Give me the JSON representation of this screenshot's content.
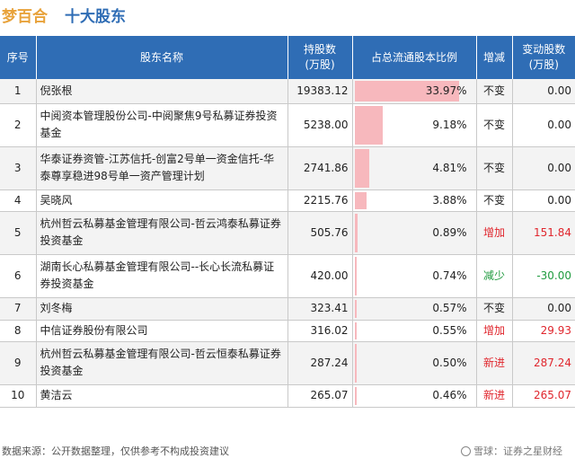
{
  "header": {
    "company": "梦百合",
    "subtitle": "十大股东"
  },
  "table": {
    "columns": {
      "rank": "序号",
      "name": "股东名称",
      "shares": "持股数\n(万股)",
      "ratio": "占总流通股本比例",
      "change": "增减",
      "delta": "变动股数\n(万股)"
    },
    "rows": [
      {
        "rank": "1",
        "name": "倪张根",
        "shares": "19383.12",
        "ratio_label": "33.97%",
        "ratio": 33.97,
        "change": "不变",
        "change_color": "#222222",
        "delta": "0.00"
      },
      {
        "rank": "2",
        "name": "中阅资本管理股份公司-中阅聚焦9号私募证券投资基金",
        "shares": "5238.00",
        "ratio_label": "9.18%",
        "ratio": 9.18,
        "change": "不变",
        "change_color": "#222222",
        "delta": "0.00"
      },
      {
        "rank": "3",
        "name": "华泰证券资管-江苏信托-创富2号单一资金信托-华泰尊享稳进98号单一资产管理计划",
        "shares": "2741.86",
        "ratio_label": "4.81%",
        "ratio": 4.81,
        "change": "不变",
        "change_color": "#222222",
        "delta": "0.00"
      },
      {
        "rank": "4",
        "name": "吴晓风",
        "shares": "2215.76",
        "ratio_label": "3.88%",
        "ratio": 3.88,
        "change": "不变",
        "change_color": "#222222",
        "delta": "0.00"
      },
      {
        "rank": "5",
        "name": "杭州哲云私募基金管理有限公司-哲云鸿泰私募证券投资基金",
        "shares": "505.76",
        "ratio_label": "0.89%",
        "ratio": 0.89,
        "change": "增加",
        "change_color": "#e0262d",
        "delta": "151.84"
      },
      {
        "rank": "6",
        "name": "湖南长心私募基金管理有限公司--长心长流私募证券投资基金",
        "shares": "420.00",
        "ratio_label": "0.74%",
        "ratio": 0.74,
        "change": "减少",
        "change_color": "#1e9a3e",
        "delta": "-30.00"
      },
      {
        "rank": "7",
        "name": "刘冬梅",
        "shares": "323.41",
        "ratio_label": "0.57%",
        "ratio": 0.57,
        "change": "不变",
        "change_color": "#222222",
        "delta": "0.00"
      },
      {
        "rank": "8",
        "name": "中信证券股份有限公司",
        "shares": "316.02",
        "ratio_label": "0.55%",
        "ratio": 0.55,
        "change": "增加",
        "change_color": "#e0262d",
        "delta": "29.93"
      },
      {
        "rank": "9",
        "name": "杭州哲云私募基金管理有限公司-哲云恒泰私募证券投资基金",
        "shares": "287.24",
        "ratio_label": "0.50%",
        "ratio": 0.5,
        "change": "新进",
        "change_color": "#e0262d",
        "delta": "287.24"
      },
      {
        "rank": "10",
        "name": "黄洁云",
        "shares": "265.07",
        "ratio_label": "0.46%",
        "ratio": 0.46,
        "change": "新进",
        "change_color": "#e0262d",
        "delta": "265.07"
      }
    ]
  },
  "footer": {
    "source": "数据来源：公开数据整理，仅供参考不构成投资建议",
    "brand": "雪球：证券之星财经"
  },
  "colors": {
    "header_bg": "#2f6db5",
    "title_company": "#e8a23a",
    "title_sub": "#2f6db5",
    "bar": "#f7b8bd",
    "up": "#e0262d",
    "down": "#1e9a3e"
  }
}
